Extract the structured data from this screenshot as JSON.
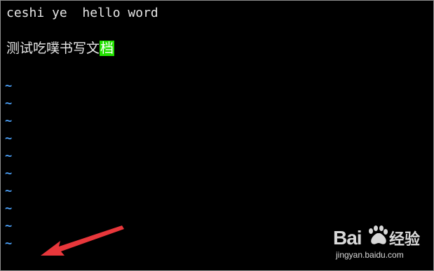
{
  "editor": {
    "line1": "ceshi ye  hello word",
    "line3_text": "测试吃噗书写文",
    "line3_cursor_char": "档",
    "tilde": "~",
    "tilde_count": 10,
    "colors": {
      "background": "#000000",
      "text": "#e6e6e6",
      "tilde": "#4a9ef5",
      "cursor_bg": "#22e000",
      "arrow": "#e8373b"
    }
  },
  "watermark": {
    "brand": "Bai  经验",
    "url": "jingyan.baidu.com"
  }
}
